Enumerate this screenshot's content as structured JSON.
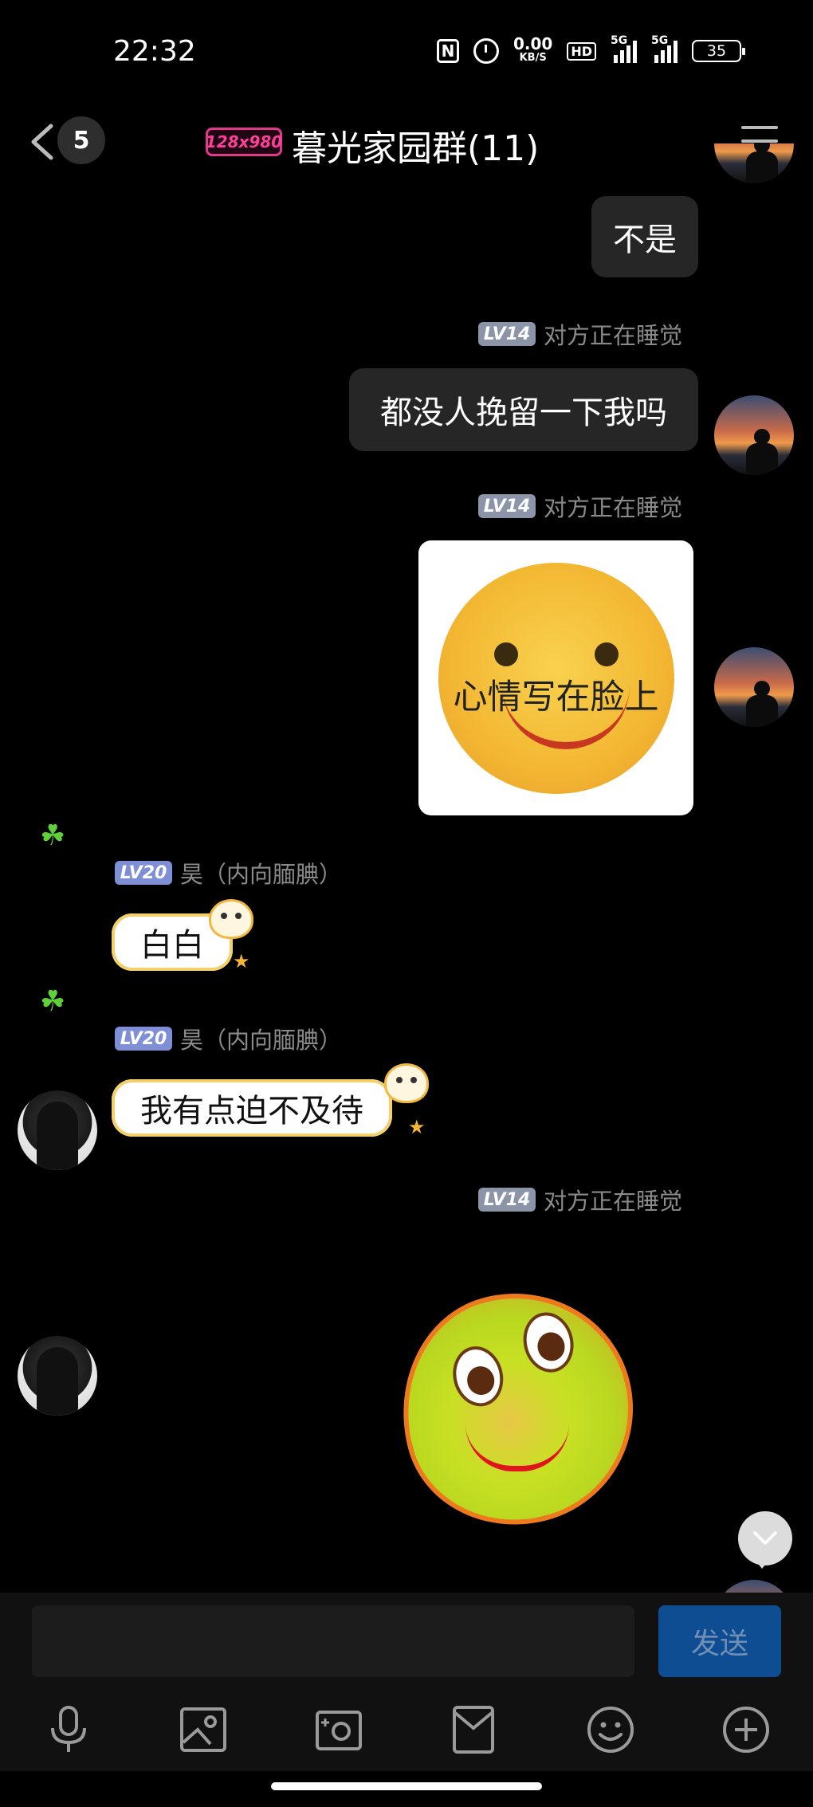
{
  "status_bar": {
    "time": "22:32",
    "nfc": "N",
    "net_speed": "0.00",
    "net_unit": "KB/S",
    "hd_label": "HD",
    "signal1_label": "5G",
    "signal2_label": "5G",
    "battery": "35"
  },
  "header": {
    "unread_count": "5",
    "group_tag": "128x980",
    "title": "暮光家园群(11)"
  },
  "messages": [
    {
      "side": "right",
      "text": "不是"
    },
    {
      "side": "right",
      "level": "LV14",
      "sender": "对方正在睡觉",
      "text": "都没人挽留一下我吗"
    },
    {
      "side": "right",
      "level": "LV14",
      "sender": "对方正在睡觉",
      "sticker": "smiley-card",
      "sticker_text": "心情写在脸上"
    },
    {
      "side": "left",
      "level": "LV20",
      "sender": "昊（内向腼腆）",
      "text": "白白"
    },
    {
      "side": "left",
      "level": "LV20",
      "sender": "昊（内向腼腆）",
      "text": "我有点迫不及待"
    },
    {
      "side": "right",
      "level": "LV14",
      "sender": "对方正在睡觉",
      "sticker": "green-blob-face"
    }
  ],
  "input": {
    "value": "",
    "placeholder": "",
    "send_label": "发送"
  },
  "toolbar": {
    "icons": [
      "microphone-icon",
      "image-icon",
      "camera-icon",
      "file-icon",
      "emoji-icon",
      "plus-icon"
    ]
  },
  "colors": {
    "background": "#000000",
    "my_bubble": "#262626",
    "send_button": "#0e4d92",
    "level14": "#8c95a8",
    "level20": "#7f8fd6"
  }
}
